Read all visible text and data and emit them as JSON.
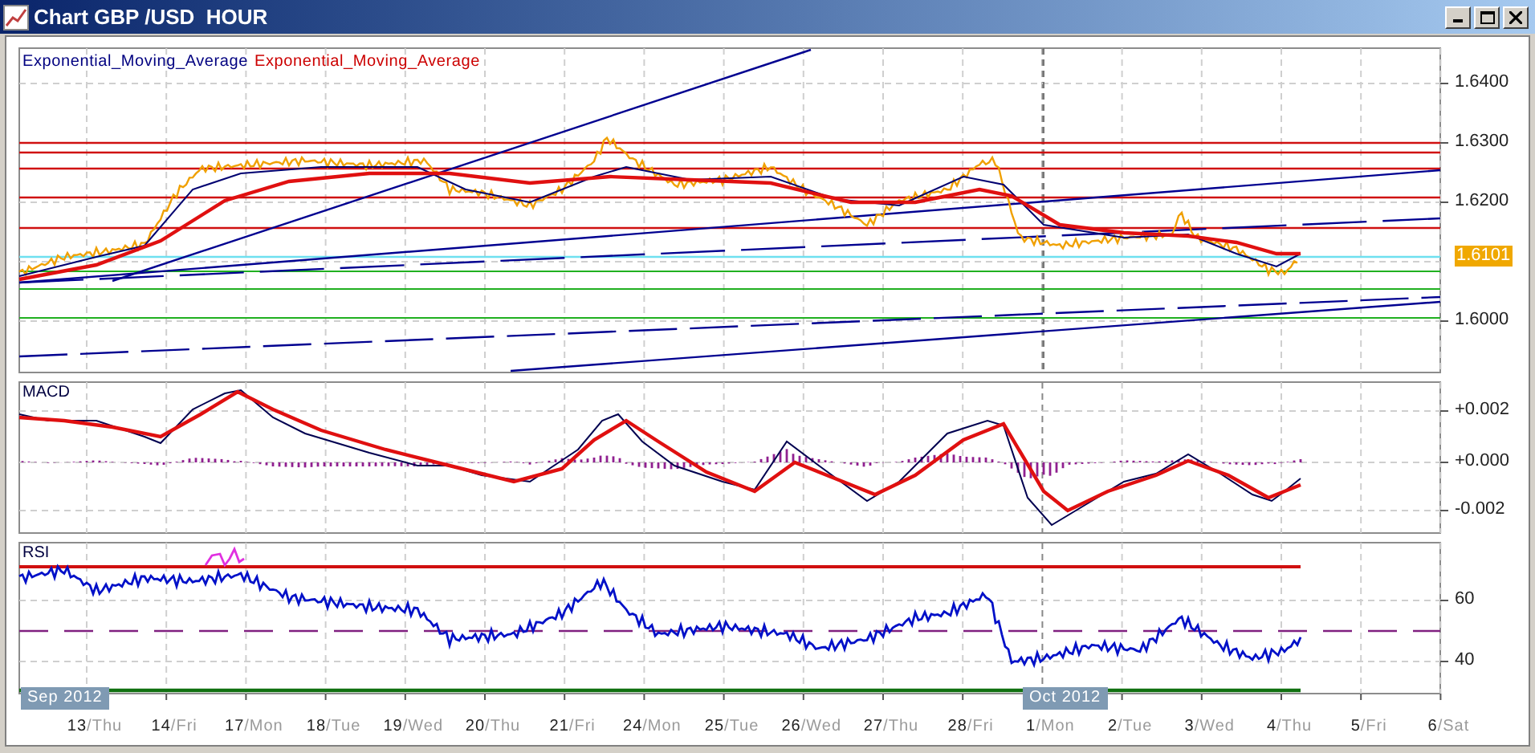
{
  "window": {
    "title": "Chart GBP /USD  HOUR"
  },
  "price_panel": {
    "legend": [
      {
        "text": "Exponential_Moving_Average",
        "color": "#000080"
      },
      {
        "text": "Exponential_Moving_Average",
        "color": "#cc0000"
      }
    ],
    "y_labels": [
      "1.6400",
      "1.6300",
      "1.6200",
      "1.6000"
    ],
    "last_price": "1.6101"
  },
  "macd_panel": {
    "title": "MACD",
    "y_labels": [
      "+0.002",
      "+0.000",
      "-0.002"
    ]
  },
  "rsi_panel": {
    "title": "RSI",
    "y_labels": [
      "60",
      "40"
    ]
  },
  "x_axis": {
    "month_labels": [
      "Sep 2012",
      "Oct 2012"
    ],
    "dates": [
      {
        "day": "13",
        "weekday": "/Thu"
      },
      {
        "day": "14",
        "weekday": "/Fri"
      },
      {
        "day": "17",
        "weekday": "/Mon"
      },
      {
        "day": "18",
        "weekday": "/Tue"
      },
      {
        "day": "19",
        "weekday": "/Wed"
      },
      {
        "day": "20",
        "weekday": "/Thu"
      },
      {
        "day": "21",
        "weekday": "/Fri"
      },
      {
        "day": "24",
        "weekday": "/Mon"
      },
      {
        "day": "25",
        "weekday": "/Tue"
      },
      {
        "day": "26",
        "weekday": "/Wed"
      },
      {
        "day": "27",
        "weekday": "/Thu"
      },
      {
        "day": "28",
        "weekday": "/Fri"
      },
      {
        "day": "1",
        "weekday": "/Mon"
      },
      {
        "day": "2",
        "weekday": "/Tue"
      },
      {
        "day": "3",
        "weekday": "/Wed"
      },
      {
        "day": "4",
        "weekday": "/Thu"
      },
      {
        "day": "5",
        "weekday": "/Fri"
      },
      {
        "day": "6",
        "weekday": "/Sat"
      }
    ]
  }
}
